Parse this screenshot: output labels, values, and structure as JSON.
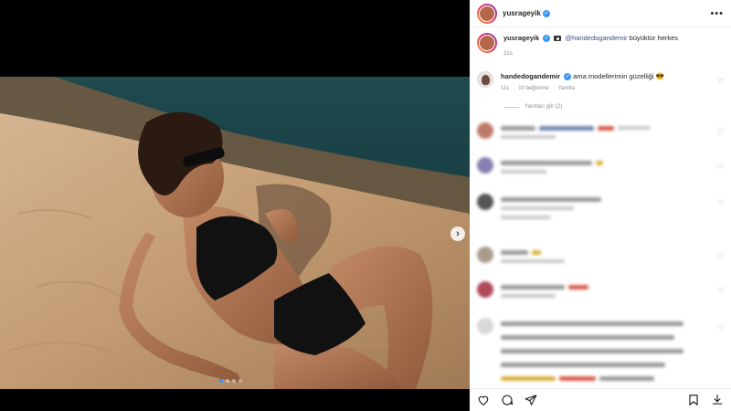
{
  "post": {
    "username": "yusrageyik",
    "caption_mention": "@handedogandemir",
    "caption_text": "büyüktür herkes",
    "caption_time": "11s"
  },
  "comment_featured": {
    "username": "handedogandemir",
    "text": "ama modellerimin güzelliği 😎",
    "time": "11s",
    "likes": "10 beğenme",
    "reply_label": "Yanıtla"
  },
  "replies_toggle": "Yanıtları gör (2)",
  "icons": {
    "verified": "verified-badge-icon",
    "more": "more-options-icon",
    "heart": "heart-icon",
    "comment": "comment-icon",
    "share": "share-icon",
    "save": "bookmark-icon",
    "next": "chevron-right-icon"
  },
  "colors": {
    "accent_blue": "#3897f0",
    "mention": "#385185",
    "muted": "#8e8e8e"
  },
  "carousel": {
    "slides": 4,
    "active": 1
  }
}
